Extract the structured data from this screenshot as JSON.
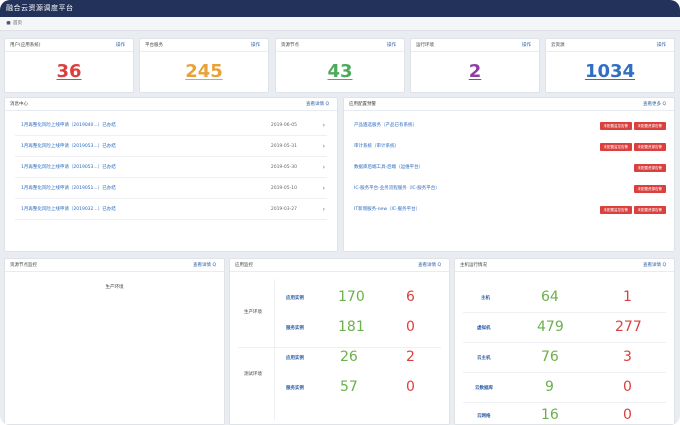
{
  "app": {
    "title": "融合云资源调度平台"
  },
  "breadcrumb": {
    "home": "首页"
  },
  "top_cards": [
    {
      "label": "用户(应用系统)",
      "action": "操作",
      "value": "36",
      "color": "#d9403e"
    },
    {
      "label": "平台服务",
      "action": "操作",
      "value": "245",
      "color": "#e8a23a"
    },
    {
      "label": "资源节点",
      "action": "操作",
      "value": "43",
      "color": "#4caa5a"
    },
    {
      "label": "运行环境",
      "action": "操作",
      "value": "2",
      "color": "#8e3fa6"
    },
    {
      "label": "云资源",
      "action": "操作",
      "value": "1034",
      "color": "#2f6fc4"
    }
  ],
  "messages": {
    "title": "消息中心",
    "more": "查看详情 Q",
    "items": [
      {
        "text": "1月再整化风险上线申请（2019040...）已办结",
        "date": "2019-06-05"
      },
      {
        "text": "1月再整化风险上线申请（2019053...）已办结",
        "date": "2019-05-31"
      },
      {
        "text": "1月再整化风险上线申请（2019053...）已办结",
        "date": "2019-05-30"
      },
      {
        "text": "1月再整化风险上线申请（2019051...）已办结",
        "date": "2019-05-10"
      },
      {
        "text": "1月再整化风险上线申请（2019032...）已办结",
        "date": "2019-03-27"
      }
    ]
  },
  "app_warnings": {
    "title": "应用配置预警",
    "more": "查看更多 Q",
    "items": [
      {
        "text": "产品遴选服务（产品已有系统）",
        "badges": [
          "未配置监控告警",
          "未配置资源告警"
        ]
      },
      {
        "text": "审计系统（审计系统）",
        "badges": [
          "未配置监控告警",
          "未配置资源告警"
        ]
      },
      {
        "text": "数据库后端工具-后端（运维平台）",
        "badges": [
          "未配置资源告警"
        ]
      },
      {
        "text": "IC-服务平台-业务流程服务（IC-服务平台）",
        "badges": [
          "未配置资源告警"
        ]
      },
      {
        "text": "IT新增服务-new（IC-服务平台）",
        "badges": [
          "未配置监控告警",
          "未配置资源告警"
        ]
      }
    ]
  },
  "node_monitor": {
    "title": "资源节点监控",
    "more": "查看详情 Q",
    "env": "生产环境"
  },
  "app_monitor": {
    "title": "应用监控",
    "more": "查看详情 Q",
    "groups": [
      {
        "env": "生产环境",
        "rows": [
          {
            "label": "应用实例",
            "ok": "170",
            "bad": "6"
          },
          {
            "label": "服务实例",
            "ok": "181",
            "bad": "0"
          }
        ]
      },
      {
        "env": "测试环境",
        "rows": [
          {
            "label": "应用实例",
            "ok": "26",
            "bad": "2"
          },
          {
            "label": "服务实例",
            "ok": "57",
            "bad": "0"
          }
        ]
      }
    ]
  },
  "host_status": {
    "title": "主机运行情况",
    "more": "查看详情 Q",
    "rows": [
      {
        "label": "主机",
        "ok": "64",
        "bad": "1"
      },
      {
        "label": "虚拟机",
        "ok": "479",
        "bad": "277"
      },
      {
        "label": "云主机",
        "ok": "76",
        "bad": "3"
      },
      {
        "label": "云数据库",
        "ok": "9",
        "bad": "0"
      },
      {
        "label": "云网络",
        "ok": "16",
        "bad": "0"
      }
    ]
  }
}
